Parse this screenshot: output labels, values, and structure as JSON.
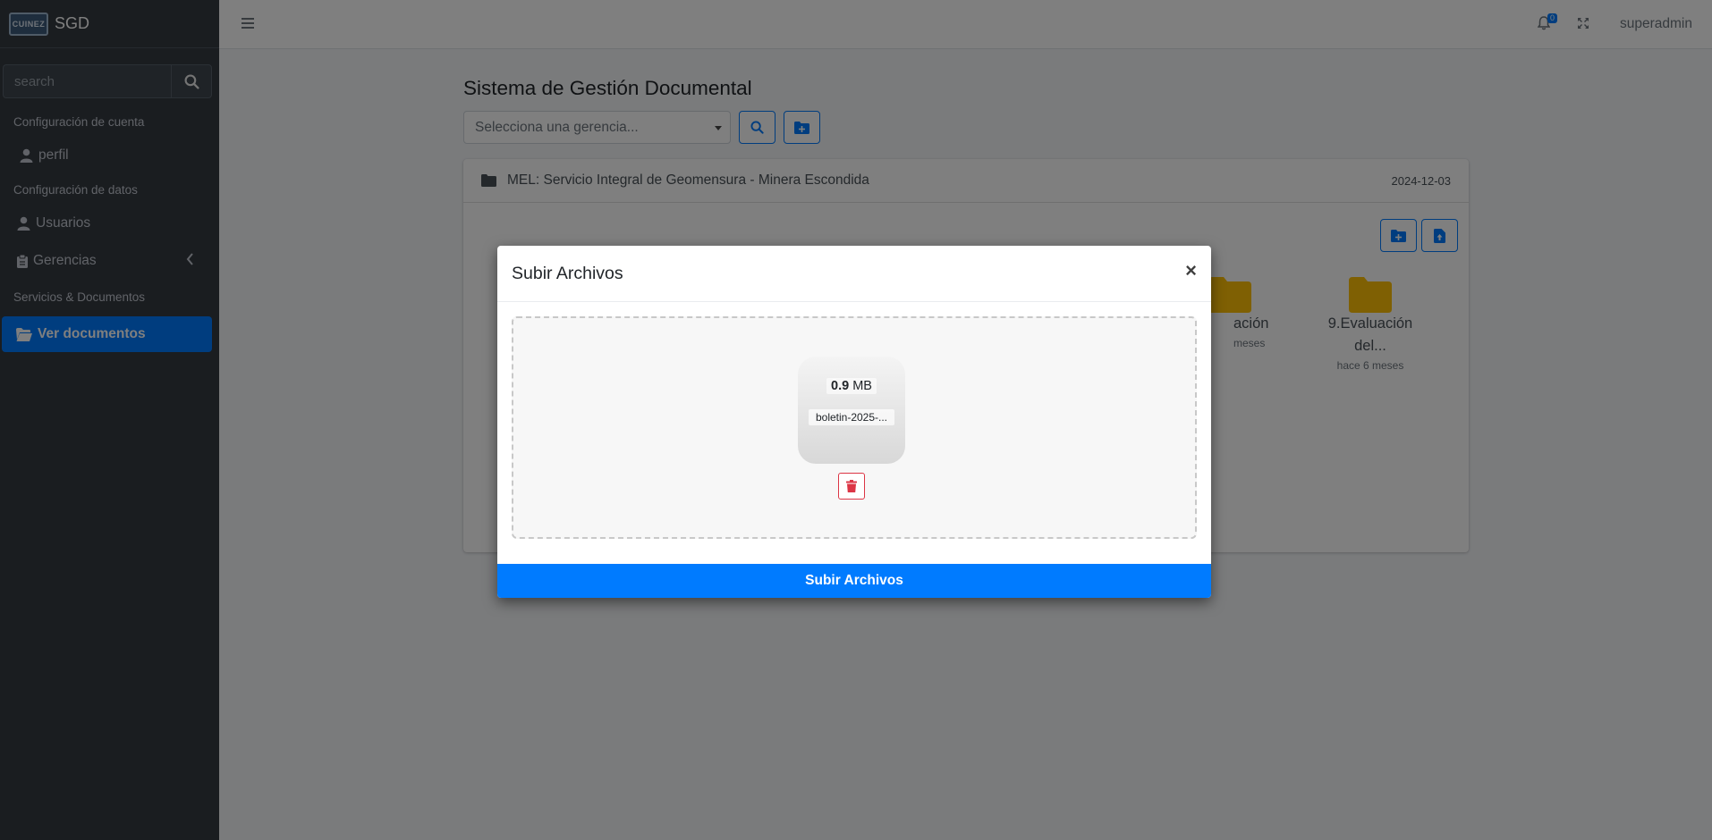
{
  "sidebar": {
    "logo_text": "CUINEZ",
    "brand": "SGD",
    "search_placeholder": "search",
    "sections": [
      {
        "header": "Configuración de cuenta"
      },
      {
        "header": "Configuración de datos"
      },
      {
        "header": "Servicios & Documentos"
      }
    ],
    "items": {
      "perfil": "perfil",
      "usuarios": "Usuarios",
      "gerencias": "Gerencias",
      "ver_documentos": "Ver documentos"
    }
  },
  "navbar": {
    "notifications_count": "0",
    "user": "superadmin"
  },
  "main": {
    "title": "Sistema de Gestión Documental",
    "select_placeholder": "Selecciona una gerencia...",
    "card": {
      "title": "MEL: Servicio Integral de Geomensura - Minera Escondida",
      "date": "2024-12-03",
      "folders": [
        {
          "name_line1": "ación",
          "name_line2": "",
          "time": "meses"
        },
        {
          "name_line1": "9.Evaluación",
          "name_line2": "del...",
          "time": "hace 6 meses"
        }
      ]
    }
  },
  "modal": {
    "title": "Subir Archivos",
    "close": "×",
    "file": {
      "size_value": "0.9",
      "size_unit": "MB",
      "name": "boletin-2025-..."
    },
    "upload_button": "Subir Archivos"
  },
  "colors": {
    "sidebar_bg": "#343a40",
    "primary": "#007bff",
    "danger": "#dc3545",
    "folder": "#ffc107"
  }
}
